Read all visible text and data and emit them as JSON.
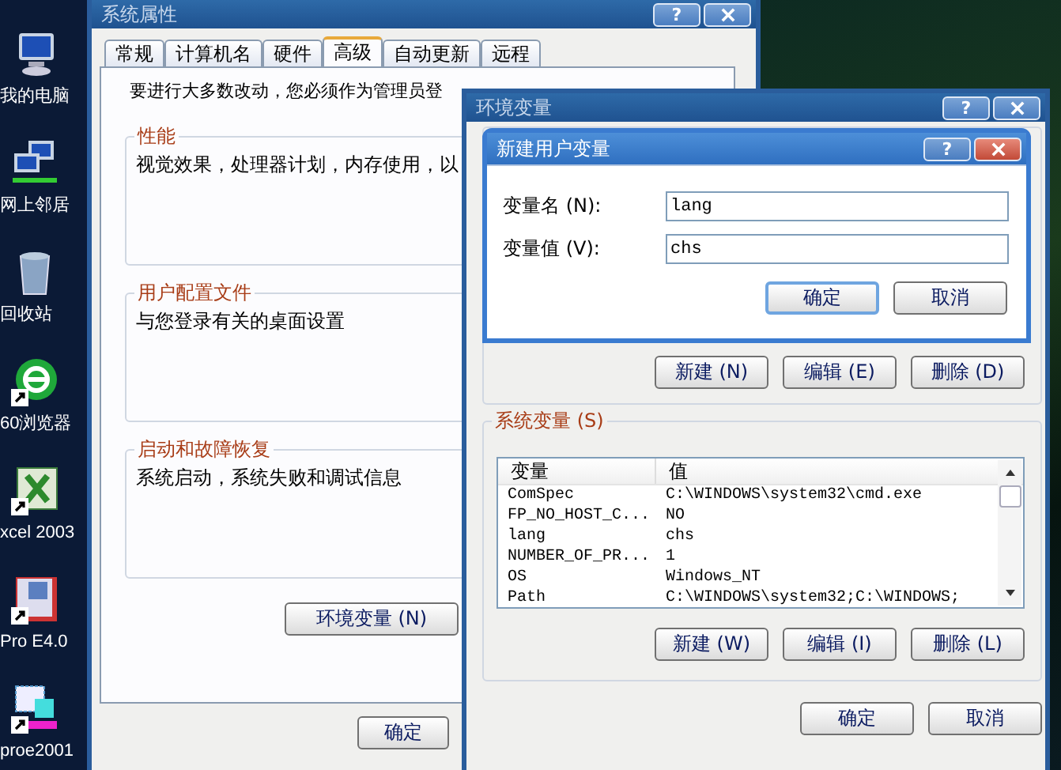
{
  "desktop": {
    "icons": [
      {
        "label": "我的电脑",
        "kind": "computer",
        "shortcut": false
      },
      {
        "label": "网上邻居",
        "kind": "network",
        "shortcut": false
      },
      {
        "label": "回收站",
        "kind": "bin",
        "shortcut": false
      },
      {
        "label": "60浏览器",
        "kind": "browser",
        "shortcut": true
      },
      {
        "label": "xcel 2003",
        "kind": "sheet",
        "shortcut": true
      },
      {
        "label": "Pro E4.0",
        "kind": "frame",
        "shortcut": true
      },
      {
        "label": "proe2001",
        "kind": "app",
        "shortcut": true
      }
    ]
  },
  "system_properties": {
    "title": "系统属性",
    "help_button": "?",
    "tabs": [
      {
        "label": "常规",
        "selected": false
      },
      {
        "label": "计算机名",
        "selected": false
      },
      {
        "label": "硬件",
        "selected": false
      },
      {
        "label": "高级",
        "selected": true
      },
      {
        "label": "自动更新",
        "selected": false
      },
      {
        "label": "远程",
        "selected": false
      }
    ],
    "notice": "要进行大多数改动，您必须作为管理员登",
    "groups": [
      {
        "title": "性能",
        "text": "视觉效果，处理器计划，内存使用，以"
      },
      {
        "title": "用户配置文件",
        "text": "与您登录有关的桌面设置"
      },
      {
        "title": "启动和故障恢复",
        "text": "系统启动，系统失败和调试信息"
      }
    ],
    "env_button": "环境变量 (N)",
    "ok_button": "确定"
  },
  "environment_variables": {
    "title": "环境变量",
    "help_button": "?",
    "user_buttons": [
      "新建 (N)",
      "编辑 (E)",
      "删除 (D)"
    ],
    "system_group": {
      "title": "系统变量 (S)",
      "columns": [
        "变量",
        "值"
      ],
      "rows": [
        {
          "name": "ComSpec",
          "value": "C:\\WINDOWS\\system32\\cmd.exe"
        },
        {
          "name": "FP_NO_HOST_C...",
          "value": "NO"
        },
        {
          "name": "lang",
          "value": "chs"
        },
        {
          "name": "NUMBER_OF_PR...",
          "value": "1"
        },
        {
          "name": "OS",
          "value": "Windows_NT"
        },
        {
          "name": "Path",
          "value": "C:\\WINDOWS\\system32;C:\\WINDOWS;"
        }
      ],
      "buttons": [
        "新建 (W)",
        "编辑 (I)",
        "删除 (L)"
      ]
    },
    "ok_button": "确定",
    "cancel_button": "取消"
  },
  "new_user_variable": {
    "title": "新建用户变量",
    "help_button": "?",
    "fields": [
      {
        "label": "变量名 (N):",
        "value": "lang"
      },
      {
        "label": "变量值 (V):",
        "value": "chs"
      }
    ],
    "buttons": [
      {
        "label": "确定",
        "default": true
      },
      {
        "label": "取消",
        "default": false
      }
    ]
  }
}
